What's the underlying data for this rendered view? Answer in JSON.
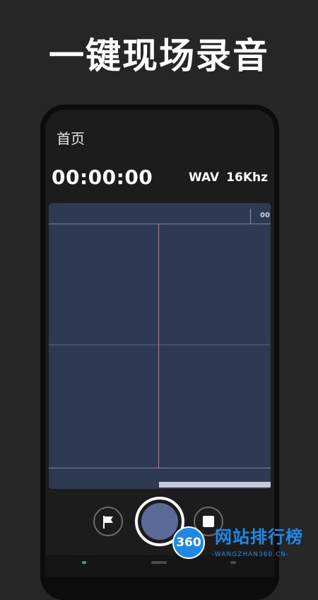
{
  "headline": "一键现场录音",
  "app": {
    "page_title": "首页",
    "timer": "00:00:00",
    "format": "WAV",
    "sample_rate": "16Khz",
    "waveform": {
      "tick_label": "00"
    },
    "controls": {
      "flag_icon": "flag-icon",
      "record_icon": "record-icon",
      "stop_icon": "stop-icon"
    }
  },
  "watermark": {
    "logo": "360",
    "name": "网站排行榜",
    "url": "-WANGZHAN360.CN-"
  },
  "colors": {
    "background": "#262626",
    "waveform_bg": "#2e3953",
    "record_fill": "#5a6b9a",
    "watermark": "#1e88e5"
  }
}
